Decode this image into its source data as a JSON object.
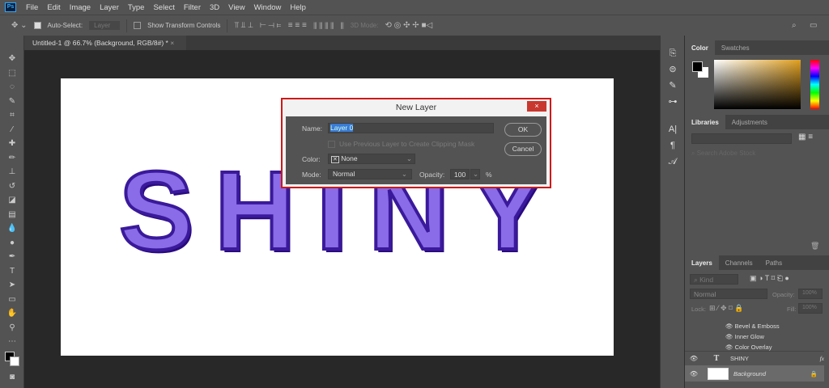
{
  "menubar": {
    "logo": "Ps",
    "items": [
      "File",
      "Edit",
      "Image",
      "Layer",
      "Type",
      "Select",
      "Filter",
      "3D",
      "View",
      "Window",
      "Help"
    ]
  },
  "options": {
    "auto_select_label": "Auto-Select:",
    "auto_select_target": "Layer",
    "show_transform_label": "Show Transform Controls",
    "mode_3d_label": "3D Mode:"
  },
  "document": {
    "tab_title": "Untitled-1 @ 66.7% (Background, RGB/8#) *",
    "close": "×",
    "canvas_text": "SHINY"
  },
  "dialog": {
    "title": "New Layer",
    "close": "×",
    "name_label": "Name:",
    "name_value": "Layer 0",
    "clipping_label": "Use Previous Layer to Create Clipping Mask",
    "color_label": "Color:",
    "color_value": "None",
    "mode_label": "Mode:",
    "mode_value": "Normal",
    "opacity_label": "Opacity:",
    "opacity_value": "100",
    "opacity_unit": "%",
    "ok_label": "OK",
    "cancel_label": "Cancel"
  },
  "color_panel": {
    "tabs": [
      "Color",
      "Swatches"
    ]
  },
  "libraries_panel": {
    "tabs": [
      "Libraries",
      "Adjustments"
    ],
    "search_placeholder": "Search Adobe Stock"
  },
  "layers_panel": {
    "tabs": [
      "Layers",
      "Channels",
      "Paths"
    ],
    "kind_placeholder": "Kind",
    "blend_mode": "Normal",
    "opacity_label": "Opacity:",
    "opacity_value": "100%",
    "lock_label": "Lock:",
    "fill_label": "Fill:",
    "fill_value": "100%",
    "effects": [
      "Bevel & Emboss",
      "Inner Glow",
      "Color Overlay"
    ],
    "layers": [
      {
        "name": "SHINY",
        "fx": "fx"
      },
      {
        "name": "Background"
      }
    ]
  },
  "colors": {
    "accent": "#31a8ff",
    "dialog_border": "#d01818",
    "text_fill": "#8a6be8",
    "text_stroke": "#3a1a9a"
  }
}
